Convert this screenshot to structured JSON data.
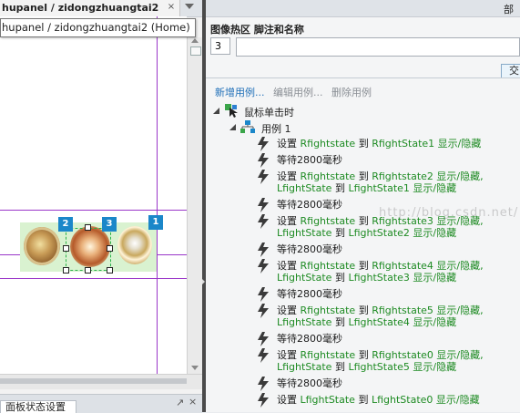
{
  "document_tab": {
    "title": "hupanel / zidongzhuangtai2",
    "close_glyph": "×"
  },
  "tooltip": "hupanel / zidongzhuangtai2 (Home)",
  "canvas": {
    "badges": [
      "2",
      "3",
      "1"
    ]
  },
  "bottom_panel": {
    "tab_label": "面板状态设置"
  },
  "right_panel": {
    "header_title": "部",
    "field_label": "图像热区 脚注和名称",
    "footnote_value": "3",
    "name_value": "",
    "interaction_tab": "交",
    "actions": {
      "new": "新增用例...",
      "edit": "编辑用例...",
      "delete": "删除用例"
    },
    "event": "鼠标单击时",
    "case": "用例 1",
    "steps": [
      {
        "lines": [
          [
            {
              "t": "设置 ",
              "k": 1
            },
            {
              "t": "Rfightstate",
              "k": 0
            },
            {
              "t": " 到 ",
              "k": 1
            },
            {
              "t": "RfightState1 显示/隐藏",
              "k": 0
            }
          ]
        ]
      },
      {
        "lines": [
          [
            {
              "t": "等待2800毫秒",
              "k": 1
            }
          ]
        ]
      },
      {
        "lines": [
          [
            {
              "t": "设置 ",
              "k": 1
            },
            {
              "t": "Rfightstate",
              "k": 0
            },
            {
              "t": " 到 ",
              "k": 1
            },
            {
              "t": "Rfightstate2 显示/隐藏,",
              "k": 0
            }
          ],
          [
            {
              "t": "LfightState",
              "k": 0
            },
            {
              "t": " 到 ",
              "k": 1
            },
            {
              "t": "LfightState1 显示/隐藏",
              "k": 0
            }
          ]
        ]
      },
      {
        "lines": [
          [
            {
              "t": "等待2800毫秒",
              "k": 1
            }
          ]
        ]
      },
      {
        "lines": [
          [
            {
              "t": "设置 ",
              "k": 1
            },
            {
              "t": "Rfightstate",
              "k": 0
            },
            {
              "t": " 到 ",
              "k": 1
            },
            {
              "t": "Rfightstate3 显示/隐藏,",
              "k": 0
            }
          ],
          [
            {
              "t": "LfightState",
              "k": 0
            },
            {
              "t": " 到 ",
              "k": 1
            },
            {
              "t": "LfightState2 显示/隐藏",
              "k": 0
            }
          ]
        ]
      },
      {
        "lines": [
          [
            {
              "t": "等待2800毫秒",
              "k": 1
            }
          ]
        ]
      },
      {
        "lines": [
          [
            {
              "t": "设置 ",
              "k": 1
            },
            {
              "t": "Rfightstate",
              "k": 0
            },
            {
              "t": " 到 ",
              "k": 1
            },
            {
              "t": "Rfightstate4 显示/隐藏,",
              "k": 0
            }
          ],
          [
            {
              "t": "LfightState",
              "k": 0
            },
            {
              "t": " 到 ",
              "k": 1
            },
            {
              "t": "LfightState3 显示/隐藏",
              "k": 0
            }
          ]
        ]
      },
      {
        "lines": [
          [
            {
              "t": "等待2800毫秒",
              "k": 1
            }
          ]
        ]
      },
      {
        "lines": [
          [
            {
              "t": "设置 ",
              "k": 1
            },
            {
              "t": "Rfightstate",
              "k": 0
            },
            {
              "t": " 到 ",
              "k": 1
            },
            {
              "t": "Rfightstate5 显示/隐藏,",
              "k": 0
            }
          ],
          [
            {
              "t": "LfightState",
              "k": 0
            },
            {
              "t": " 到 ",
              "k": 1
            },
            {
              "t": "LfightState4 显示/隐藏",
              "k": 0
            }
          ]
        ]
      },
      {
        "lines": [
          [
            {
              "t": "等待2800毫秒",
              "k": 1
            }
          ]
        ]
      },
      {
        "lines": [
          [
            {
              "t": "设置 ",
              "k": 1
            },
            {
              "t": "Rfightstate",
              "k": 0
            },
            {
              "t": " 到 ",
              "k": 1
            },
            {
              "t": "Rfightstate0 显示/隐藏,",
              "k": 0
            }
          ],
          [
            {
              "t": "LfightState",
              "k": 0
            },
            {
              "t": " 到 ",
              "k": 1
            },
            {
              "t": "LfightState5 显示/隐藏",
              "k": 0
            }
          ]
        ]
      },
      {
        "lines": [
          [
            {
              "t": "等待2800毫秒",
              "k": 1
            }
          ]
        ]
      },
      {
        "lines": [
          [
            {
              "t": "设置 ",
              "k": 1
            },
            {
              "t": "LfightState",
              "k": 0
            },
            {
              "t": " 到 ",
              "k": 1
            },
            {
              "t": "LfightState0 显示/隐藏",
              "k": 0
            }
          ]
        ]
      }
    ]
  },
  "watermark": "http://blog.csdn.net/",
  "colors": {
    "accent_blue": "#1b87c9",
    "guide_purple": "#9a36c9",
    "action_green": "#1e8b23",
    "link_blue": "#1f6fb8"
  }
}
